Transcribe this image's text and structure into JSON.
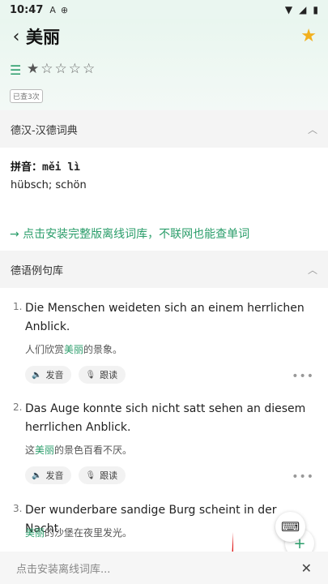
{
  "status": {
    "time": "10:47",
    "icons": [
      "A",
      "⊕"
    ],
    "right_icons": [
      "▼",
      "◢",
      "▮"
    ]
  },
  "header": {
    "title": "美丽",
    "query_badge": "已查3次",
    "rating": 1,
    "rating_max": 5
  },
  "dict_section": {
    "title": "德汉-汉德词典",
    "pinyin_label": "拼音：",
    "pinyin": "měi lì",
    "meaning": "hübsch; schön",
    "install_link": "→ 点击安装完整版离线词库，不联网也能查单词"
  },
  "example_section": {
    "title": "德语例句库",
    "examples": [
      {
        "num": "1.",
        "de": "Die Menschen weideten sich an einem herrlichen Anblick.",
        "zh_pre": "人们欣赏",
        "zh_hl": "美丽",
        "zh_post": "的景象。"
      },
      {
        "num": "2.",
        "de": "Das Auge konnte sich nicht satt sehen an diesem herrlichen Anblick.",
        "zh_pre": "这",
        "zh_hl": "美丽",
        "zh_post": "的景色百看不厌。"
      },
      {
        "num": "3.",
        "de": "Der wunderbare sandige Burg scheint in der Nacht",
        "zh_pre": "",
        "zh_hl": "美丽",
        "zh_post": "的沙堡在夜里发光。"
      }
    ],
    "pronounce_label": "发音",
    "follow_label": "跟读"
  },
  "bottom": {
    "placeholder": "点击安装离线词库...",
    "close": "✕"
  },
  "colors": {
    "accent": "#2a9d6a",
    "star": "#f2b01e",
    "annotation": "#e02020"
  }
}
